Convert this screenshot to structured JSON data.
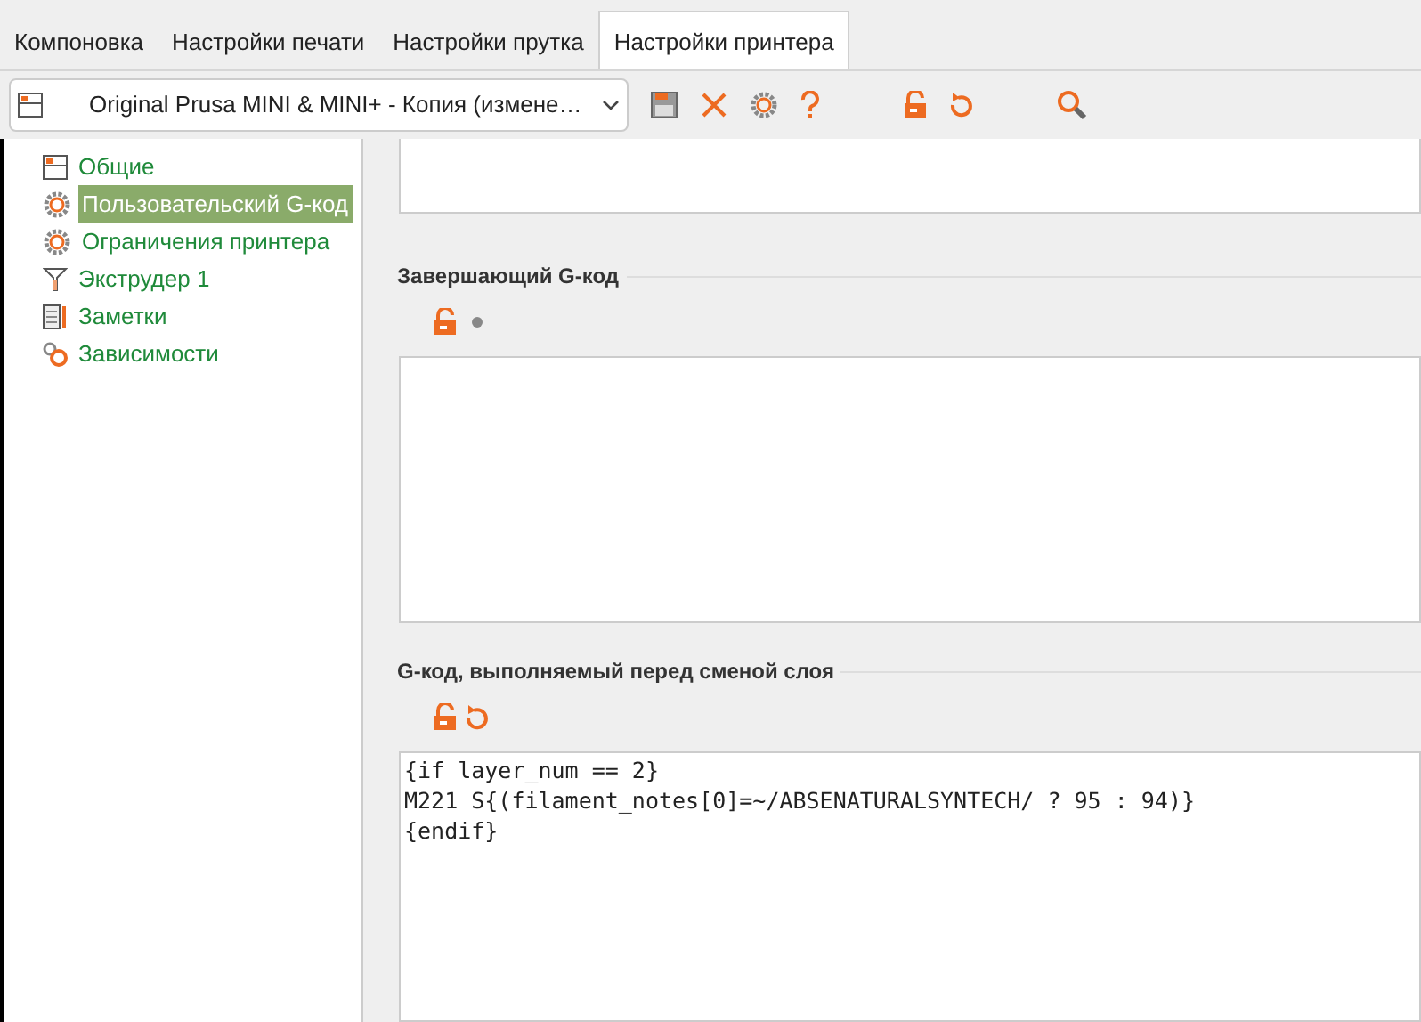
{
  "tabs": [
    {
      "label": "Компоновка",
      "selected": false
    },
    {
      "label": "Настройки печати",
      "selected": false
    },
    {
      "label": "Настройки прутка",
      "selected": false
    },
    {
      "label": "Настройки принтера",
      "selected": true
    }
  ],
  "preset": {
    "value": "Original Prusa MINI & MINI+ - Копия (измене…"
  },
  "toolbar": [
    {
      "kind": "save"
    },
    {
      "kind": "delete"
    },
    {
      "kind": "gear"
    },
    {
      "kind": "help"
    },
    {
      "kind": "gap"
    },
    {
      "kind": "lock"
    },
    {
      "kind": "undo"
    },
    {
      "kind": "gap"
    },
    {
      "kind": "search"
    }
  ],
  "sidebar": {
    "items": [
      {
        "label": "Общие",
        "kind": "window",
        "selected": false
      },
      {
        "label": "Пользовательский G-код",
        "kind": "gear",
        "selected": true
      },
      {
        "label": "Ограничения принтера",
        "kind": "gear",
        "selected": false
      },
      {
        "label": "Экструдер 1",
        "kind": "extruder",
        "selected": false
      },
      {
        "label": "Заметки",
        "kind": "notes",
        "selected": false
      },
      {
        "label": "Зависимости",
        "kind": "deps",
        "selected": false
      }
    ]
  },
  "sections": [
    {
      "kind": "partial"
    },
    {
      "kind": "full",
      "title": "Завершающий G-код",
      "modified": false
    },
    {
      "kind": "full",
      "title": "G-код, выполняемый перед сменой слоя",
      "modified": true,
      "code": [
        "{if layer_num == 2}",
        "M221 S{(filament_notes[0]=~/ABSENATURALSYNTECH/ ? 95 : 94)}",
        "{endif}"
      ]
    }
  ]
}
